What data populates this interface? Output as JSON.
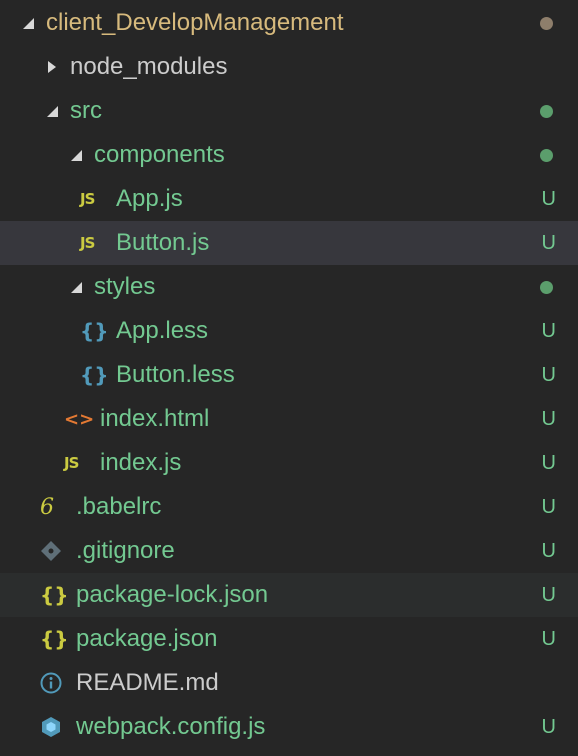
{
  "explorer": {
    "items": [
      {
        "label": "client_DevelopManagement",
        "type": "folder",
        "expanded": true,
        "depth": 0,
        "icon": "none",
        "status": "dot",
        "status_color": "#8e7e6b",
        "label_color": "brown"
      },
      {
        "label": "node_modules",
        "type": "folder",
        "expanded": false,
        "depth": 1,
        "icon": "none",
        "status": "",
        "label_color": "plain"
      },
      {
        "label": "src",
        "type": "folder",
        "expanded": true,
        "depth": 1,
        "icon": "none",
        "status": "dot",
        "status_color": "#5b9e6c",
        "label_color": "green"
      },
      {
        "label": "components",
        "type": "folder",
        "expanded": true,
        "depth": 2,
        "icon": "none",
        "status": "dot",
        "status_color": "#5b9e6c",
        "label_color": "green"
      },
      {
        "label": "App.js",
        "type": "file",
        "depth": 3,
        "icon": "js-icon",
        "icon_text": "JS",
        "status": "U",
        "label_color": "green"
      },
      {
        "label": "Button.js",
        "type": "file",
        "depth": 3,
        "icon": "js-icon",
        "icon_text": "JS",
        "status": "U",
        "label_color": "green",
        "selected": true
      },
      {
        "label": "styles",
        "type": "folder",
        "expanded": true,
        "depth": 2,
        "icon": "none",
        "status": "dot",
        "status_color": "#5b9e6c",
        "label_color": "green"
      },
      {
        "label": "App.less",
        "type": "file",
        "depth": 3,
        "icon": "less-icon",
        "icon_text": "{}",
        "status": "U",
        "label_color": "green"
      },
      {
        "label": "Button.less",
        "type": "file",
        "depth": 3,
        "icon": "less-icon",
        "icon_text": "{}",
        "status": "U",
        "label_color": "green"
      },
      {
        "label": "index.html",
        "type": "file",
        "depth": 2,
        "icon": "html-icon",
        "icon_text": "<>",
        "status": "U",
        "label_color": "green"
      },
      {
        "label": "index.js",
        "type": "file",
        "depth": 2,
        "icon": "js-icon",
        "icon_text": "JS",
        "status": "U",
        "label_color": "green"
      },
      {
        "label": ".babelrc",
        "type": "file",
        "depth": 1,
        "icon": "babel-icon",
        "icon_text": "6",
        "status": "U",
        "label_color": "green"
      },
      {
        "label": ".gitignore",
        "type": "file",
        "depth": 1,
        "icon": "git-icon",
        "icon_text": "",
        "status": "U",
        "label_color": "green"
      },
      {
        "label": "package-lock.json",
        "type": "file",
        "depth": 1,
        "icon": "json-icon",
        "icon_text": "{}",
        "status": "U",
        "label_color": "green",
        "hover": true
      },
      {
        "label": "package.json",
        "type": "file",
        "depth": 1,
        "icon": "json-icon",
        "icon_text": "{}",
        "status": "U",
        "label_color": "green"
      },
      {
        "label": "README.md",
        "type": "file",
        "depth": 1,
        "icon": "info-icon",
        "icon_text": "",
        "status": "",
        "label_color": "plain"
      },
      {
        "label": "webpack.config.js",
        "type": "file",
        "depth": 1,
        "icon": "webpack-icon",
        "icon_text": "",
        "status": "U",
        "label_color": "green"
      }
    ]
  }
}
